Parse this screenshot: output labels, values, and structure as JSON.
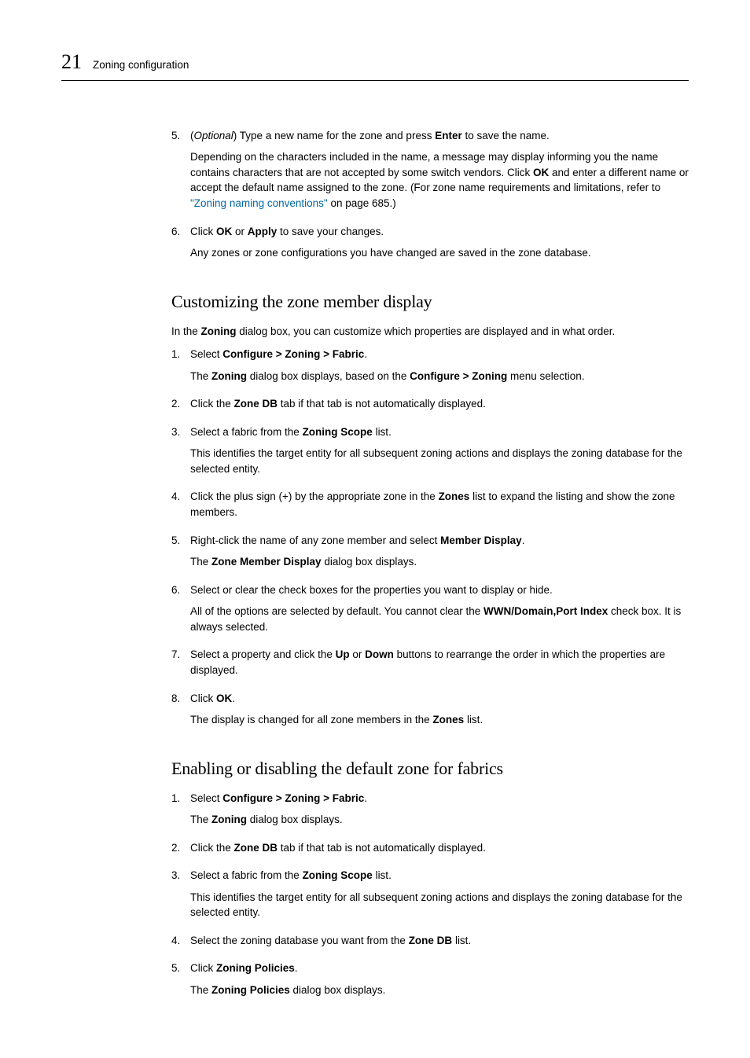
{
  "header": {
    "chapter_number": "21",
    "chapter_title": "Zoning configuration"
  },
  "topList": [
    {
      "num": "5.",
      "main_pre": "(",
      "optional": "Optional",
      "main_mid1": ") Type a new name for the zone and press ",
      "bold1": "Enter",
      "main_post1": " to save the name.",
      "sub_pre": "Depending on the characters included in the name, a message may display informing you the name contains characters that are not accepted by some switch vendors. Click ",
      "bold2": "OK",
      "sub_mid": " and enter a different name or accept the default name assigned to the zone. (For zone name requirements and limitations, refer to ",
      "link": "\"Zoning naming conventions\"",
      "sub_post": " on page 685.)"
    },
    {
      "num": "6.",
      "main_pre": "Click ",
      "bold1": "OK",
      "main_mid1": " or ",
      "bold2": "Apply",
      "main_post1": " to save your changes.",
      "sub": "Any zones or zone configurations you have changed are saved in the zone database."
    }
  ],
  "section1": {
    "title": "Customizing the zone member display",
    "intro_pre": "In the ",
    "intro_bold": "Zoning",
    "intro_post": " dialog box, you can customize which properties are displayed and in what order.",
    "items": [
      {
        "num": "1.",
        "main_pre": "Select ",
        "bold1": "Configure > Zoning > Fabric",
        "main_post1": ".",
        "sub_pre": "The ",
        "sub_b1": "Zoning",
        "sub_mid": " dialog box displays, based on the ",
        "sub_b2": "Configure > Zoning",
        "sub_post": " menu selection."
      },
      {
        "num": "2.",
        "main_pre": "Click the ",
        "bold1": "Zone DB",
        "main_post1": " tab if that tab is not automatically displayed."
      },
      {
        "num": "3.",
        "main_pre": "Select a fabric from the ",
        "bold1": "Zoning Scope",
        "main_post1": " list.",
        "sub": "This identifies the target entity for all subsequent zoning actions and displays the zoning database for the selected entity."
      },
      {
        "num": "4.",
        "main_pre": "Click the plus sign (+) by the appropriate zone in the ",
        "bold1": "Zones",
        "main_post1": " list to expand the listing and show the zone members."
      },
      {
        "num": "5.",
        "main_pre": "Right-click the name of any zone member and select ",
        "bold1": "Member Display",
        "main_post1": ".",
        "sub_pre": "The ",
        "sub_b1": "Zone Member Display",
        "sub_post": " dialog box displays."
      },
      {
        "num": "6.",
        "main_pre": "Select or clear the check boxes for the properties you want to display or hide.",
        "sub_pre": "All of the options are selected by default. You cannot clear the ",
        "sub_b1": "WWN/Domain,Port Index",
        "sub_post": " check box. It is always selected."
      },
      {
        "num": "7.",
        "main_pre": "Select a property and click the ",
        "bold1": "Up",
        "main_mid1": " or ",
        "bold2": "Down",
        "main_post1": " buttons to rearrange the order in which the properties are displayed."
      },
      {
        "num": "8.",
        "main_pre": "Click ",
        "bold1": "OK",
        "main_post1": ".",
        "sub_pre": "The display is changed for all zone members in the ",
        "sub_b1": "Zones",
        "sub_post": " list."
      }
    ]
  },
  "section2": {
    "title": "Enabling or disabling the default zone for fabrics",
    "items": [
      {
        "num": "1.",
        "main_pre": "Select ",
        "bold1": "Configure > Zoning > Fabric",
        "main_post1": ".",
        "sub_pre": "The ",
        "sub_b1": "Zoning",
        "sub_post": " dialog box displays."
      },
      {
        "num": "2.",
        "main_pre": "Click the ",
        "bold1": "Zone DB",
        "main_post1": " tab if that tab is not automatically displayed."
      },
      {
        "num": "3.",
        "main_pre": "Select a fabric from the ",
        "bold1": "Zoning Scope",
        "main_post1": " list.",
        "sub": "This identifies the target entity for all subsequent zoning actions and displays the zoning database for the selected entity."
      },
      {
        "num": "4.",
        "main_pre": "Select the zoning database you want from the ",
        "bold1": "Zone DB",
        "main_post1": " list."
      },
      {
        "num": "5.",
        "main_pre": "Click ",
        "bold1": "Zoning Policies",
        "main_post1": ".",
        "sub_pre": "The ",
        "sub_b1": "Zoning Policies",
        "sub_post": " dialog box displays."
      }
    ]
  }
}
